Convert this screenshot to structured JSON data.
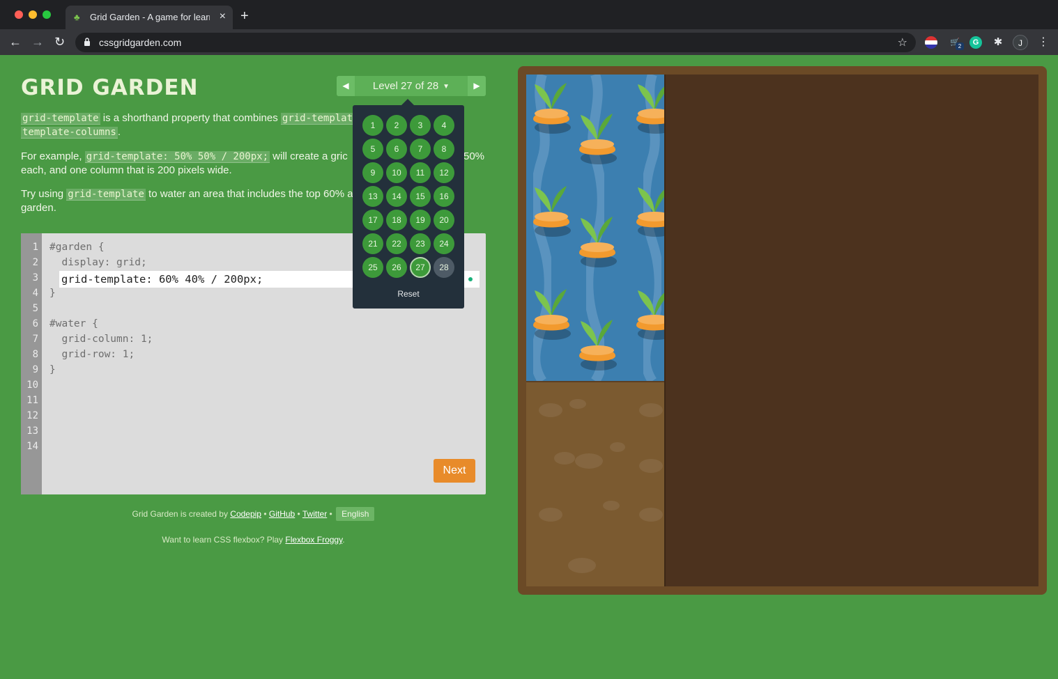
{
  "browser": {
    "tab_title": "Grid Garden - A game for learn",
    "url": "cssgridgarden.com",
    "extension_badge": "2",
    "avatar_letter": "J"
  },
  "header": {
    "title": "GRID GARDEN",
    "level_label": "Level 27 of 28"
  },
  "instructions": {
    "p1_code1": "grid-template",
    "p1_text1": " is a shorthand property that combines ",
    "p1_code2": "grid-templat",
    "p1_code3": "template-columns",
    "p1_text2": ".",
    "p2_text1": "For example, ",
    "p2_code1": "grid-template: 50% 50% / 200px;",
    "p2_text2": " will create a gric",
    "p2_text3": "50%",
    "p2_text4": "each, and one column that is 200 pixels wide.",
    "p3_text1": "Try using ",
    "p3_code1": "grid-template",
    "p3_text2": " to water an area that includes the top 60% ar",
    "p3_text3": "garden."
  },
  "editor": {
    "line_numbers": [
      "1",
      "2",
      "3",
      "4",
      "5",
      "6",
      "7",
      "8",
      "9",
      "10",
      "11",
      "12",
      "13",
      "14"
    ],
    "lines": {
      "l1": "#garden {",
      "l2": "  display: grid;",
      "l4": "}",
      "l6": "#water {",
      "l7": "  grid-column: 1;",
      "l8": "  grid-row: 1;",
      "l9": "}"
    },
    "input_value": "grid-template: 60% 40% / 200px;",
    "next_label": "Next"
  },
  "footer": {
    "credit_prefix": "Grid Garden is created by ",
    "codepip": "Codepip",
    "sep": " • ",
    "github": "GitHub",
    "twitter": "Twitter",
    "language": "English",
    "flex_prefix": "Want to learn CSS flexbox? Play ",
    "flex_link": "Flexbox Froggy",
    "flex_suffix": "."
  },
  "level_menu": {
    "levels": [
      "1",
      "2",
      "3",
      "4",
      "5",
      "6",
      "7",
      "8",
      "9",
      "10",
      "11",
      "12",
      "13",
      "14",
      "15",
      "16",
      "17",
      "18",
      "19",
      "20",
      "21",
      "22",
      "23",
      "24",
      "25",
      "26",
      "27",
      "28"
    ],
    "current_level": "27",
    "reset_label": "Reset"
  },
  "colors": {
    "background": "#4a9a44",
    "accent_next": "#e88b2a",
    "water": "#3c7fb0",
    "soil": "#4c321e"
  }
}
